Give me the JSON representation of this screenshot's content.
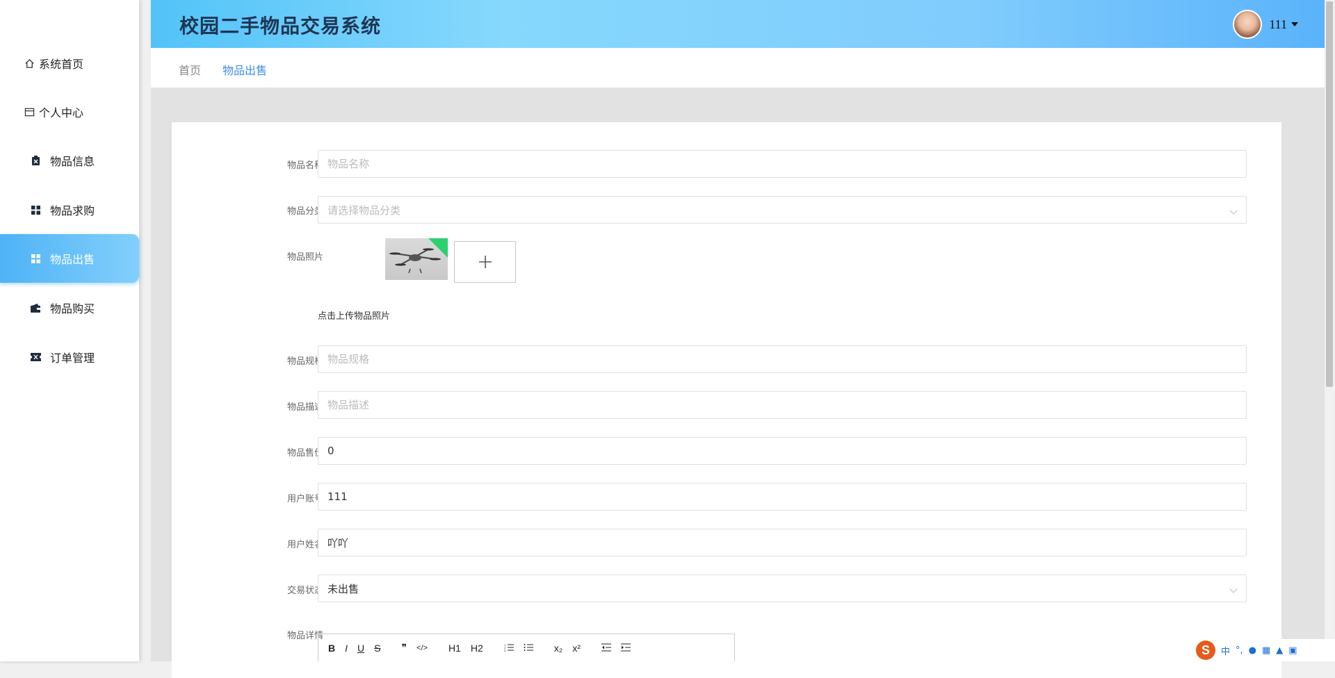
{
  "sidebar": {
    "items": [
      {
        "label": "系统首页",
        "icon": "home-icon"
      },
      {
        "label": "个人中心",
        "icon": "id-card-icon"
      },
      {
        "label": "物品信息",
        "icon": "clipboard-icon"
      },
      {
        "label": "物品求购",
        "icon": "grid-icon"
      },
      {
        "label": "物品出售",
        "icon": "grid-icon",
        "active": true
      },
      {
        "label": "物品购买",
        "icon": "wallet-icon"
      },
      {
        "label": "订单管理",
        "icon": "ticket-icon"
      }
    ]
  },
  "header": {
    "title": "校园二手物品交易系统",
    "user_name": "111"
  },
  "breadcrumb": {
    "items": [
      "首页",
      "物品出售"
    ]
  },
  "form": {
    "name": {
      "label": "物品名称",
      "placeholder": "物品名称",
      "value": ""
    },
    "category": {
      "label": "物品分类",
      "placeholder": "请选择物品分类"
    },
    "photo": {
      "label": "物品照片",
      "hint": "点击上传物品照片"
    },
    "spec": {
      "label": "物品规格",
      "placeholder": "物品规格"
    },
    "desc": {
      "label": "物品描述",
      "placeholder": "物品描述"
    },
    "price": {
      "label": "物品售价",
      "value": "0"
    },
    "account": {
      "label": "用户账号",
      "value": "111"
    },
    "username": {
      "label": "用户姓名",
      "value": "吖吖"
    },
    "status": {
      "label": "交易状态",
      "value": "未出售"
    },
    "detail": {
      "label": "物品详情"
    }
  },
  "editor_toolbar": [
    "B",
    "I",
    "U",
    "S",
    "❞",
    "</>",
    "H1",
    "H2",
    "ol",
    "ul",
    "x₂",
    "x²",
    "outdent",
    "indent"
  ],
  "ime": {
    "label": "中"
  }
}
